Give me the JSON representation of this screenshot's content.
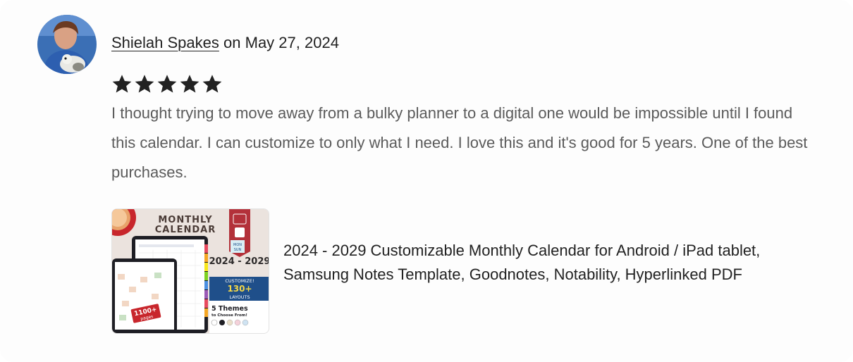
{
  "review": {
    "reviewer_name": "Shielah Spakes",
    "date_prefix": "on",
    "date": "May 27, 2024",
    "rating": 5,
    "rating_max": 5,
    "text": "I thought trying to move away from a bulky planner to a digital one would be impossible until I found this calendar. I can customize to only what I need. I love this and it's good for 5 years. One of the best purchases."
  },
  "listing": {
    "title": "2024 - 2029 Customizable Monthly Calendar for Android / iPad tablet, Samsung Notes Template, Goodnotes, Notability, Hyperlinked PDF",
    "thumbnail": {
      "heading_line1": "MONTHLY",
      "heading_line2": "CALENDAR",
      "years": "2024 - 2029",
      "badge_top": "CUSTOMIZE!",
      "badge_count": "130+",
      "badge_bottom": "LAYOUTS",
      "themes_line1": "5 Themes",
      "themes_line2": "to Choose From!",
      "pages_count": "1100+",
      "pages_label": "pages",
      "ribbon_top": "MON",
      "ribbon_bottom": "SUN"
    }
  },
  "colors": {
    "star": "#222222",
    "text_secondary": "#5b5b5b",
    "badge_navy": "#1f4f8a",
    "ribbon_red": "#b3313a",
    "pages_red": "#c8262c"
  }
}
